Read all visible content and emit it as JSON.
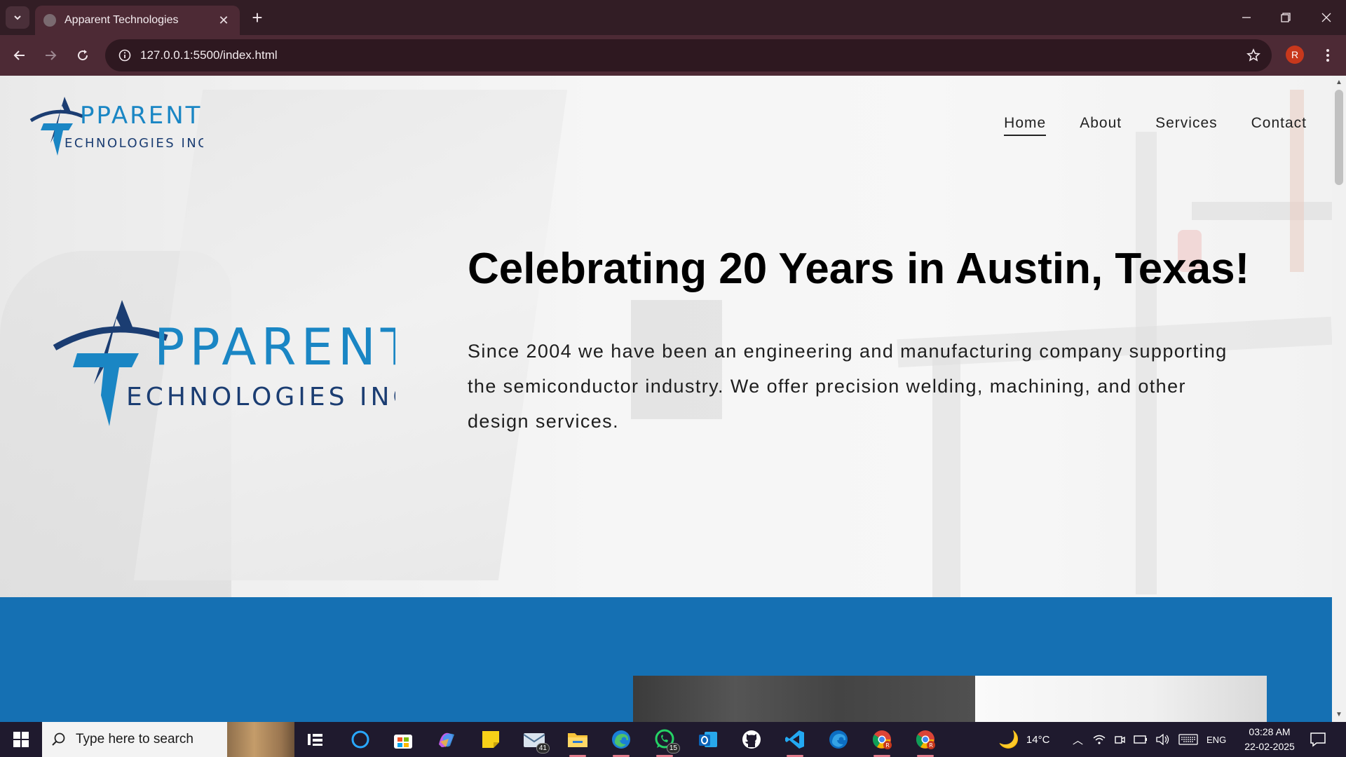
{
  "browser": {
    "tab_title": "Apparent Technologies",
    "url": "127.0.0.1:5500/index.html",
    "profile_initial": "R"
  },
  "site": {
    "logo": {
      "letter": "A",
      "word1": "PPARENT",
      "letter2": "T",
      "word2": "ECHNOLOGIES INC."
    },
    "nav": [
      "Home",
      "About",
      "Services",
      "Contact"
    ],
    "active_nav": "Home",
    "headline": "Celebrating 20 Years in Austin, Texas!",
    "intro": "Since 2004 we have been an engineering and manufacturing company supporting the semiconductor industry. We offer precision welding, machining, and other design services.",
    "colors": {
      "logo_dark": "#1b3d72",
      "logo_light": "#1a86c4",
      "band": "#1570b3"
    }
  },
  "taskbar": {
    "search_placeholder": "Type here to search",
    "mail_badge": "41",
    "whatsapp_badge": "15",
    "weather": "14°C",
    "language": "ENG",
    "time": "03:28 AM",
    "date": "22-02-2025",
    "chrome_profile_initial": "R"
  }
}
